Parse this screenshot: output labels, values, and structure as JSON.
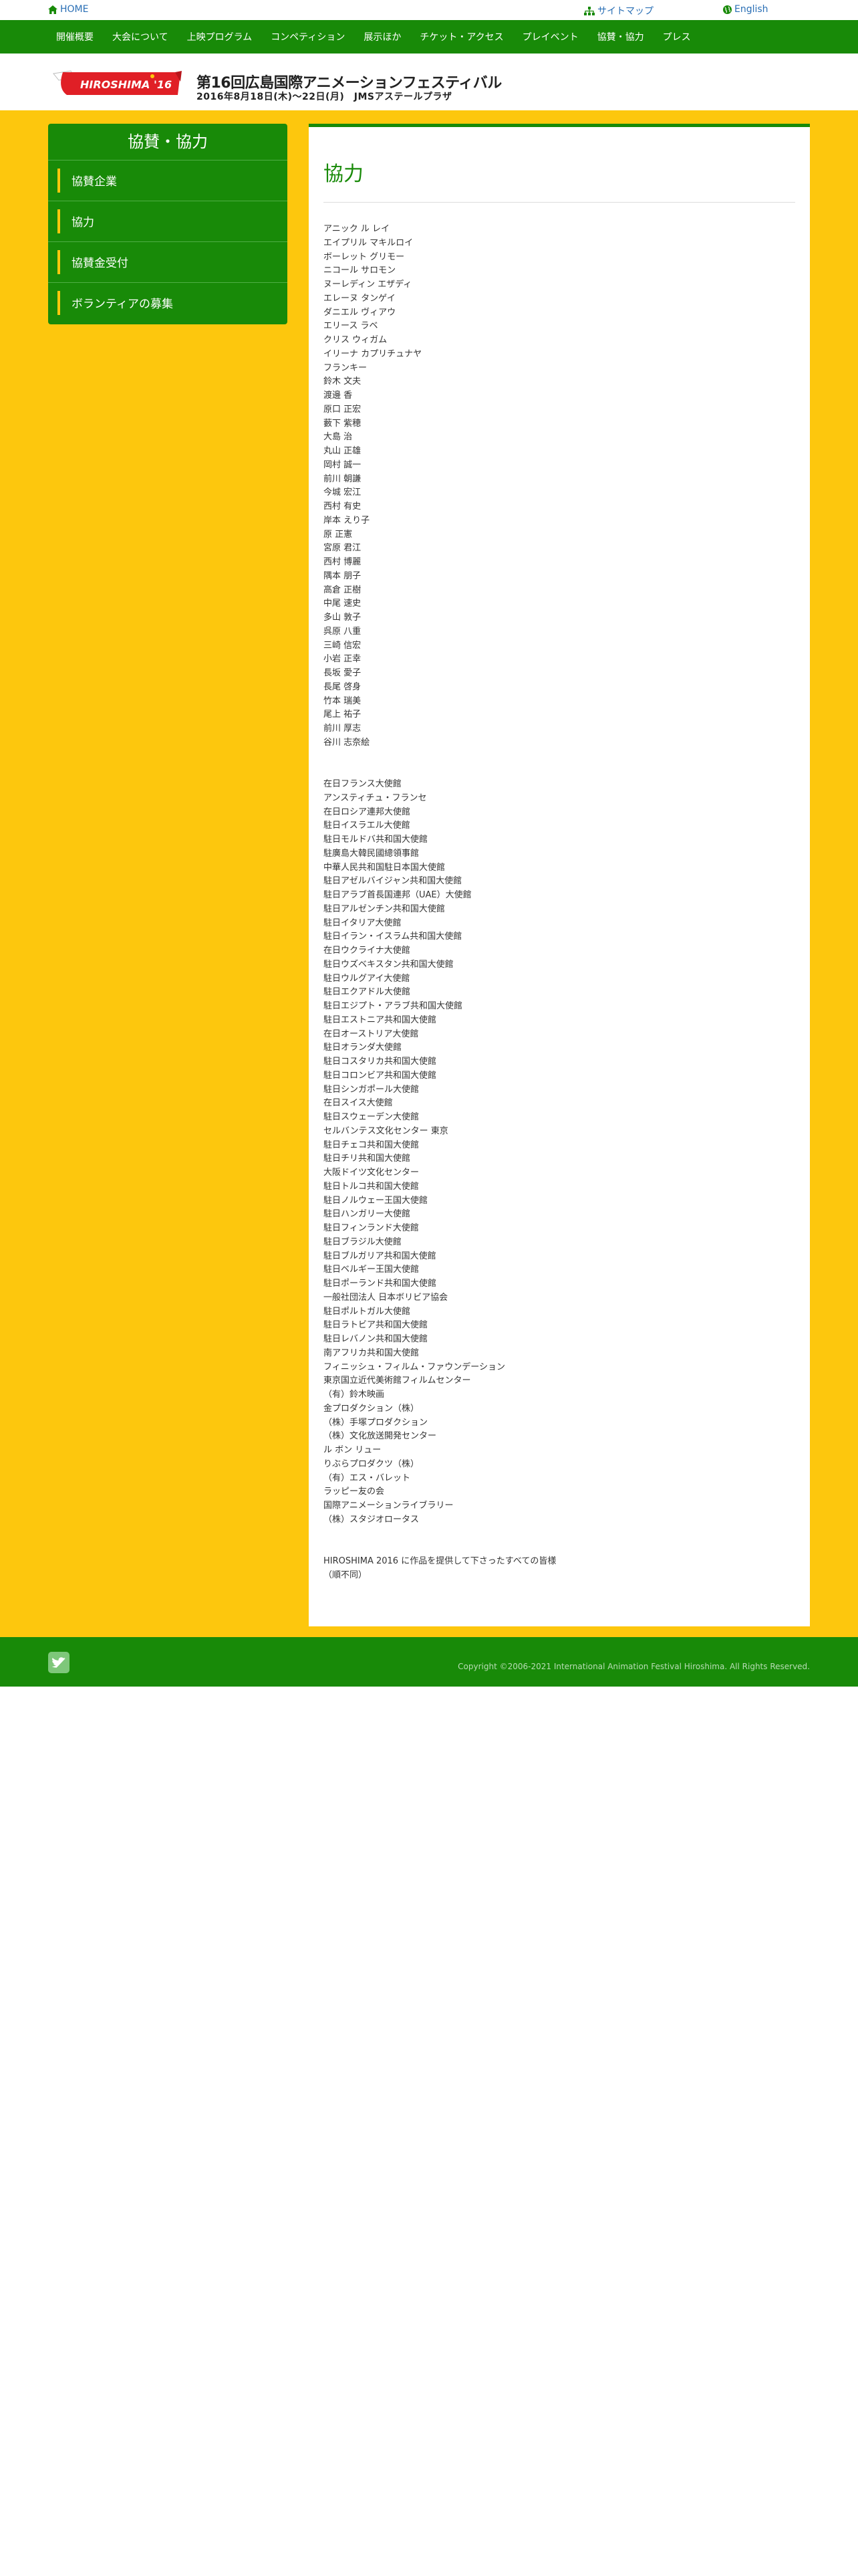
{
  "topbar": {
    "home": "HOME",
    "sitemap": "サイトマップ",
    "english": "English"
  },
  "nav": {
    "items": [
      "開催概要",
      "大会について",
      "上映プログラム",
      "コンペティション",
      "展示ほか",
      "チケット・アクセス",
      "プレイベント",
      "協賛・協力",
      "プレス"
    ]
  },
  "banner": {
    "logo_text": "HIROSHIMA '16",
    "title": "第16回広島国際アニメーションフェスティバル",
    "dates": "2016年8月18日(木)〜22日(月)　JMSアステールプラザ"
  },
  "sidebar": {
    "title": "協賛・協力",
    "items": [
      "協賛企業",
      "協力",
      "協賛金受付",
      "ボランティアの募集"
    ]
  },
  "main": {
    "heading": "協力",
    "people": [
      "アニック ル レイ",
      "エイプリル マキルロイ",
      "ボーレット グリモー",
      "ニコール サロモン",
      "ヌーレディン エザディ",
      "エレーヌ タンゲイ",
      "ダニエル ヴィアウ",
      "エリース ラベ",
      "クリス ウィガム",
      "イリーナ カプリチュナヤ",
      "フランキー",
      "鈴木 文夫",
      "渡邊 香",
      "原口 正宏",
      "藪下 紫穂",
      "大島 治",
      "丸山 正雄",
      "岡村 誠一",
      "前川 朝謙",
      "今城 宏江",
      "西村 有史",
      "岸本 えり子",
      "原 正憲",
      "宮原 君江",
      "西村 博麗",
      "隅本 朋子",
      "高倉 正樹",
      "中尾 速史",
      "多山 敦子",
      "呉原 八重",
      "三崎 信宏",
      "小岩 正幸",
      "長坂 愛子",
      "長尾 啓身",
      "竹本 瑞美",
      "尾上 祐子",
      "前川 厚志",
      "谷川 志奈絵"
    ],
    "organizations": [
      "在日フランス大使館",
      "アンスティチュ・フランセ",
      "在日ロシア連邦大使館",
      "駐日イスラエル大使館",
      "駐日モルドバ共和国大使館",
      "駐廣島大韓民國總領事館",
      "中華人民共和国駐日本国大使館",
      "駐日アゼルバイジャン共和国大使館",
      "駐日アラブ首長国連邦（UAE）大使館",
      "駐日アルゼンチン共和国大使館",
      "駐日イタリア大使館",
      "駐日イラン・イスラム共和国大使館",
      "在日ウクライナ大使館",
      "駐日ウズベキスタン共和国大使館",
      "駐日ウルグアイ大使館",
      "駐日エクアドル大使館",
      "駐日エジプト・アラブ共和国大使館",
      "駐日エストニア共和国大使館",
      "在日オーストリア大使館",
      "駐日オランダ大使館",
      "駐日コスタリカ共和国大使館",
      "駐日コロンビア共和国大使館",
      "駐日シンガポール大使館",
      "在日スイス大使館",
      "駐日スウェーデン大使館",
      "セルバンテス文化センター 東京",
      "駐日チェコ共和国大使館",
      "駐日チリ共和国大使館",
      "大阪ドイツ文化センター",
      "駐日トルコ共和国大使館",
      "駐日ノルウェー王国大使館",
      "駐日ハンガリー大使館",
      "駐日フィンランド大使館",
      "駐日ブラジル大使館",
      "駐日ブルガリア共和国大使館",
      "駐日ベルギー王国大使館",
      "駐日ポーランド共和国大使館",
      "一般社団法人 日本ボリビア協会",
      "駐日ポルトガル大使館",
      "駐日ラトビア共和国大使館",
      "駐日レバノン共和国大使館",
      "南アフリカ共和国大使館",
      "フィニッシュ・フィルム・ファウンデーション",
      "東京国立近代美術館フィルムセンター",
      "（有）鈴木映画",
      "金プロダクション（株）",
      "（株）手塚プロダクション",
      "（株）文化放送開発センター",
      "ル ボン リュー",
      "りぶらプロダクツ（株）",
      "（有）エス・バレット",
      "ラッピー友の会",
      "国際アニメーションライブラリー",
      "（株）スタジオロータス"
    ],
    "closing": [
      "HIROSHIMA 2016 に作品を提供して下さったすべての皆様",
      "（順不同）"
    ]
  },
  "footer": {
    "copyright": "Copyright ©2006-2021 International Animation Festival Hiroshima. All Rights Reserved."
  },
  "colors": {
    "green": "#188a08",
    "gold": "#fdc70d",
    "link": "#2a6fb5"
  }
}
